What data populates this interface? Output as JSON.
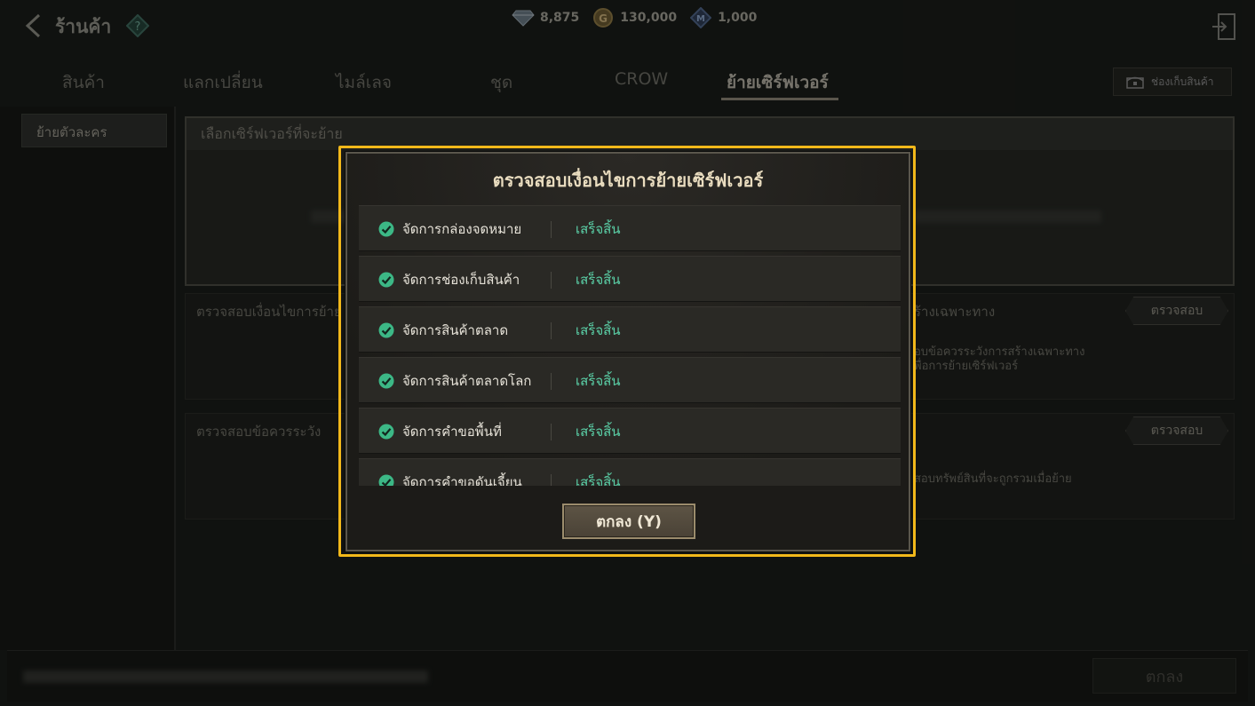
{
  "header": {
    "title": "ร้านค้า",
    "currencies": [
      {
        "icon": "diamond-icon",
        "value": "8,875"
      },
      {
        "icon": "gold-coin-icon",
        "value": "130,000"
      },
      {
        "icon": "m-coin-icon",
        "value": "1,000"
      }
    ]
  },
  "tabs": [
    {
      "label": "สินค้า"
    },
    {
      "label": "แลกเปลี่ยน"
    },
    {
      "label": "ไมล์เลจ"
    },
    {
      "label": "ชุด"
    },
    {
      "label": "CROW"
    },
    {
      "label": "ย้ายเซิร์ฟเวอร์"
    }
  ],
  "storage_button": "ช่องเก็บสินค้า",
  "sidebar": {
    "items": [
      {
        "label": "ย้ายตัวละคร"
      }
    ]
  },
  "select_panel": {
    "header": "เลือกเซิร์ฟเวอร์ที่จะย้าย"
  },
  "conditions_panel": {
    "label": "ตรวจสอบเงื่อนไขการย้าย",
    "right_label": "ร้างเฉพาะทาง",
    "button": "ตรวจสอบ",
    "desc_line1": "อบข้อควรระวังการสร้างเฉพาะทาง",
    "desc_line2": "พื่อการย้ายเซิร์ฟเวอร์"
  },
  "caution_panel": {
    "label": "ตรวจสอบข้อควรระวัง",
    "button": "ตรวจสอบ",
    "desc": "สอบทรัพย์สินที่จะถูกรวมเมื่อย้าย"
  },
  "footer": {
    "ok": "ตกลง"
  },
  "modal": {
    "title": "ตรวจสอบเงื่อนไขการย้ายเซิร์ฟเวอร์",
    "items": [
      {
        "name": "จัดการกล่องจดหมาย",
        "status": "เสร็จสิ้น"
      },
      {
        "name": "จัดการช่องเก็บสินค้า",
        "status": "เสร็จสิ้น"
      },
      {
        "name": "จัดการสินค้าตลาด",
        "status": "เสร็จสิ้น"
      },
      {
        "name": "จัดการสินค้าตลาดโลก",
        "status": "เสร็จสิ้น"
      },
      {
        "name": "จัดการคำขอพื้นที่",
        "status": "เสร็จสิ้น"
      },
      {
        "name": "จัดการคำขอดันเจี้ยน",
        "status": "เสร็จสิ้น"
      }
    ],
    "ok_button": "ตกลง (Y)"
  },
  "colors": {
    "accent": "#f2b81a",
    "status": "#5bd1a8"
  }
}
